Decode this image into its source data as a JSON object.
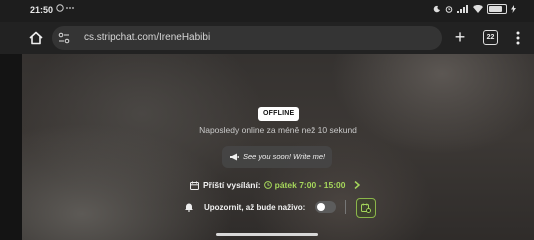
{
  "status_bar": {
    "time": "21:50",
    "left_icons": "○ ···",
    "right_icons": "☾ ❁ ▂▄▆ ◢"
  },
  "browser": {
    "url": "cs.stripchat.com/IreneHabibi",
    "tab_count": "22",
    "new_tab_glyph": "+"
  },
  "stream": {
    "status_badge": "OFFLINE",
    "last_online": "Naposledy online za méně než 10 sekund",
    "message": "See you soon! Write me!",
    "schedule_label": "Příští vysílání:",
    "schedule_time": "pátek 7:00 - 15:00",
    "notify_label": "Upozornit, až bude naživo:",
    "notify_enabled": false
  },
  "colors": {
    "accent_green": "#a5d65b",
    "badge_bg": "#ffffff"
  }
}
